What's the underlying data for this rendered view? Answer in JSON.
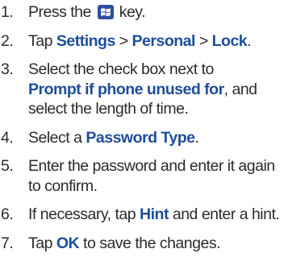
{
  "steps": [
    {
      "n": "1.",
      "t1": "Press the ",
      "t2": " key."
    },
    {
      "n": "2.",
      "a": "Tap ",
      "b": "Settings",
      "c": " > ",
      "d": "Personal",
      "e": " > ",
      "f": "Lock",
      "g": "."
    },
    {
      "n": "3.",
      "a": "Select the check box next to",
      "b": "Prompt if phone unused for",
      "c": ", and select the length of time."
    },
    {
      "n": "4.",
      "a": "Select a ",
      "b": "Password Type",
      "c": "."
    },
    {
      "n": "5.",
      "a": "Enter the password and enter it again to confirm."
    },
    {
      "n": "6.",
      "a": "If necessary, tap ",
      "b": "Hint",
      "c": " and enter a hint."
    },
    {
      "n": "7.",
      "a": "Tap ",
      "b": "OK",
      "c": " to save the changes."
    }
  ],
  "icons": {
    "start_key": "windows-start-key-icon"
  },
  "colors": {
    "keyword": "#1d4e9a",
    "text": "#2b2b2b",
    "key_bg": "#2c4f9c"
  }
}
